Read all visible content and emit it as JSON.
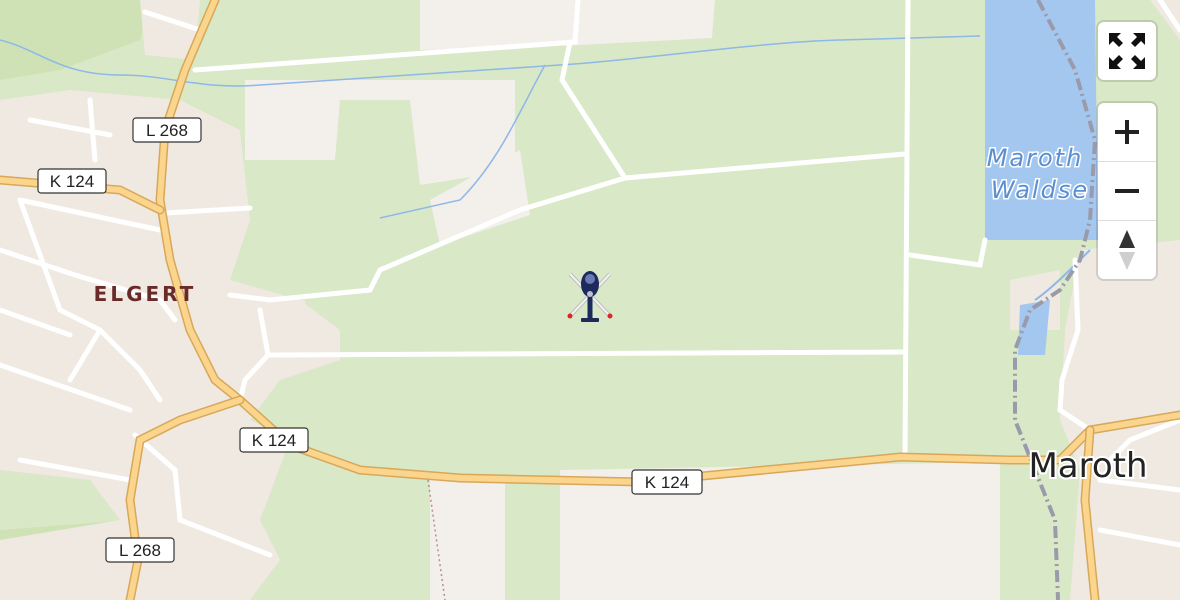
{
  "map": {
    "road_labels": [
      "L 268",
      "K 124",
      "K 124",
      "K 124",
      "L 268"
    ],
    "place_labels": [
      "ELGERT",
      "Maroth"
    ],
    "water_label_lines": [
      "Maroth",
      "Waldse"
    ]
  },
  "controls": {
    "fullscreen_icon": "fullscreen-icon",
    "zoom_in_icon": "plus-icon",
    "zoom_out_icon": "minus-icon",
    "compass_icon": "compass-icon"
  },
  "marker": {
    "icon": "helicopter-icon",
    "colors": {
      "body": "#1d2a5c",
      "rotor": "#e6e6e6",
      "tip": "#d62828"
    }
  },
  "colors": {
    "meadow": "#d9e8c6",
    "forest": "#cfe2b6",
    "settlement": "#efe9e1",
    "field": "#f3efeb",
    "water": "#a4c7ef",
    "major_road": "#fbd58c",
    "minor_road": "#ffffff"
  }
}
